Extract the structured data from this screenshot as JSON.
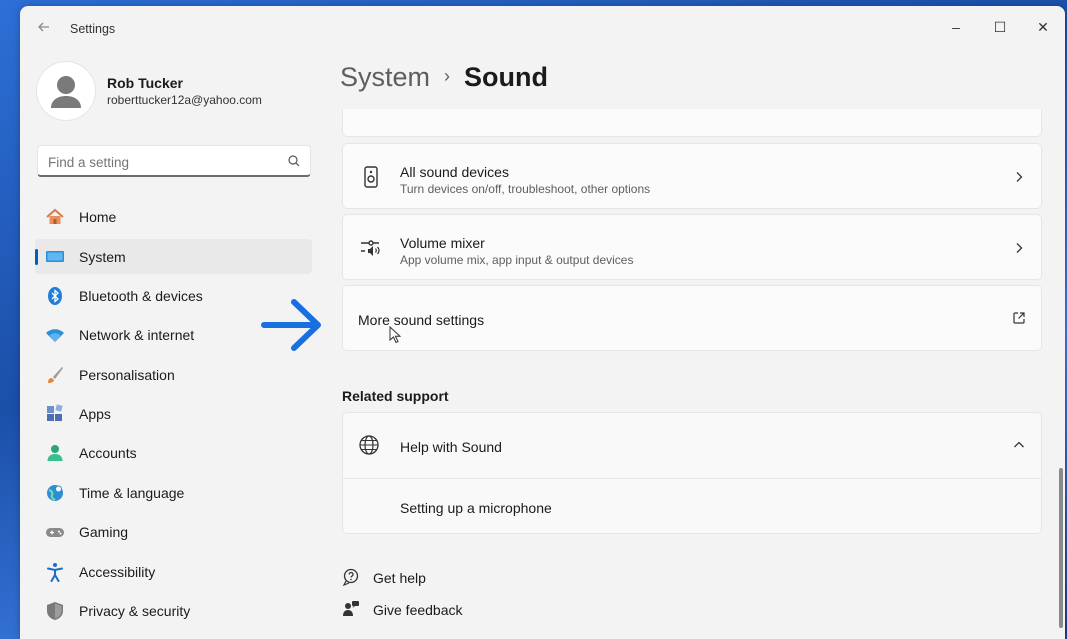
{
  "window": {
    "title": "Settings",
    "back_icon": "back-arrow-icon"
  },
  "controls": {
    "minimize": "–",
    "maximize": "☐",
    "close": "✕"
  },
  "profile": {
    "name": "Rob Tucker",
    "email": "roberttucker12a@yahoo.com"
  },
  "search": {
    "placeholder": "Find a setting",
    "value": ""
  },
  "nav": {
    "items": [
      {
        "label": "Home",
        "icon": "home-icon"
      },
      {
        "label": "System",
        "icon": "system-icon",
        "active": true
      },
      {
        "label": "Bluetooth & devices",
        "icon": "bluetooth-icon"
      },
      {
        "label": "Network & internet",
        "icon": "wifi-icon"
      },
      {
        "label": "Personalisation",
        "icon": "brush-icon"
      },
      {
        "label": "Apps",
        "icon": "apps-icon"
      },
      {
        "label": "Accounts",
        "icon": "accounts-icon"
      },
      {
        "label": "Time & language",
        "icon": "globe-clock-icon"
      },
      {
        "label": "Gaming",
        "icon": "gamepad-icon"
      },
      {
        "label": "Accessibility",
        "icon": "accessibility-icon"
      },
      {
        "label": "Privacy & security",
        "icon": "shield-icon"
      }
    ]
  },
  "breadcrumb": {
    "parent": "System",
    "separator": "›",
    "current": "Sound"
  },
  "cards": {
    "all_devices": {
      "title": "All sound devices",
      "subtitle": "Turn devices on/off, troubleshoot, other options",
      "icon": "speaker-icon"
    },
    "volume_mixer": {
      "title": "Volume mixer",
      "subtitle": "App volume mix, app input & output devices",
      "icon": "mixer-icon"
    },
    "more_sound": {
      "title": "More sound settings",
      "icon": "open-external-icon"
    }
  },
  "related": {
    "heading": "Related support",
    "help_title": "Help with Sound",
    "help_item": "Setting up a microphone"
  },
  "footer": {
    "get_help": "Get help",
    "give_feedback": "Give feedback"
  },
  "colors": {
    "accent": "#005fb8",
    "annotation_arrow": "#1a6fe0"
  }
}
